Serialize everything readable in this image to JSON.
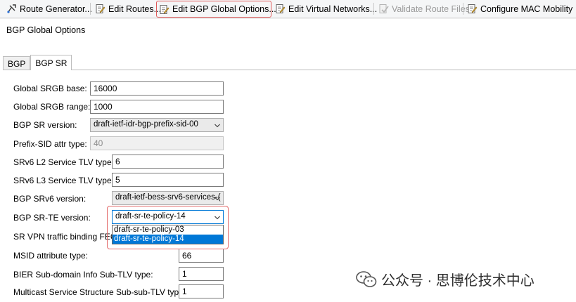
{
  "toolbar": {
    "items": [
      {
        "label": "Route Generator...",
        "icon": "route-generator-icon",
        "enabled": true,
        "highlighted": false
      },
      {
        "label": "Edit Routes...",
        "icon": "edit-document-icon",
        "enabled": true,
        "highlighted": false
      },
      {
        "label": "Edit BGP Global Options...",
        "icon": "edit-document-icon",
        "enabled": true,
        "highlighted": true
      },
      {
        "label": "Edit Virtual Networks...",
        "icon": "edit-document-icon",
        "enabled": true,
        "highlighted": false
      },
      {
        "label": "Validate Route Files",
        "icon": "validate-icon",
        "enabled": false,
        "highlighted": false
      },
      {
        "label": "Configure MAC Mobility",
        "icon": "edit-document-icon",
        "enabled": true,
        "highlighted": false
      }
    ]
  },
  "window": {
    "title": "BGP Global Options",
    "tabs": [
      {
        "label": "BGP",
        "active": false
      },
      {
        "label": "BGP SR",
        "active": true
      }
    ]
  },
  "form": {
    "global_srgb_base": {
      "label": "Global SRGB base:",
      "value": "16000"
    },
    "global_srgb_range": {
      "label": "Global SRGB range:",
      "value": "1000"
    },
    "bgp_sr_version": {
      "label": "BGP SR version:",
      "value": "draft-ietf-idr-bgp-prefix-sid-00"
    },
    "prefix_sid_attr_type": {
      "label": "Prefix-SID attr type:",
      "value": "40"
    },
    "srv6_l2_tlv_type": {
      "label": "SRv6 L2 Service TLV type:",
      "value": "6"
    },
    "srv6_l3_tlv_type": {
      "label": "SRv6 L3 Service TLV type:",
      "value": "5"
    },
    "bgp_srv6_version": {
      "label": "BGP SRv6 version:",
      "value": "draft-ietf-bess-srv6-services-("
    },
    "bgp_srte_version": {
      "label": "BGP SR-TE version:",
      "value": "draft-sr-te-policy-14",
      "options": [
        "draft-sr-te-policy-03",
        "draft-sr-te-policy-14"
      ],
      "selected_index": 1
    },
    "sr_vpn_binding": {
      "label": "SR VPN traffic binding FEC t"
    },
    "msid_attr_type": {
      "label": "MSID attribute type:",
      "value": "66"
    },
    "bier_subdomain_tlv": {
      "label": "BIER Sub-domain Info Sub-TLV type:",
      "value": "1"
    },
    "multicast_service_subsub_tlv": {
      "label": "Multicast Service Structure Sub-sub-TLV type:",
      "value": "1"
    }
  },
  "watermark": {
    "text": "公众号 · 思博伦技术中心",
    "icon": "wechat-logo-icon"
  },
  "colors": {
    "highlight_red": "#e05a5a",
    "selection_blue": "#0078d7"
  }
}
